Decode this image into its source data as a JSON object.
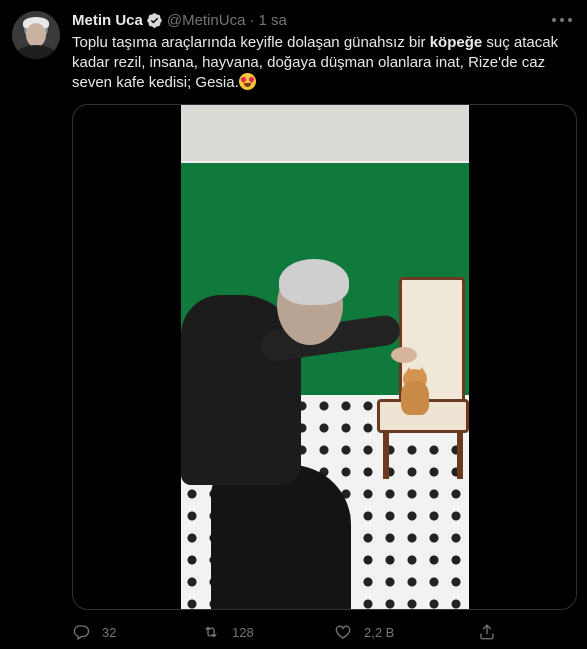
{
  "tweet": {
    "author_name": "Metin Uca",
    "handle": "@MetinUca",
    "separator": "·",
    "time": "1 sa",
    "text_part1": "Toplu taşıma araçlarında keyifle dolaşan günahsız bir ",
    "text_bold": "köpeğe",
    "text_part2": " suç atacak kadar rezil, insana, hayvana, doğaya düşman olanlara inat, Rize'de caz seven kafe kedisi; Gesia.",
    "emoji": "smiling-face-with-heart-eyes"
  },
  "actions": {
    "reply_count": "32",
    "retweet_count": "128",
    "like_count": "2,2 B"
  },
  "icons": [
    "verified-icon",
    "more-icon",
    "reply-icon",
    "retweet-icon",
    "like-icon",
    "share-icon"
  ],
  "colors": {
    "background": "#000000",
    "text": "#e7e9ea",
    "muted": "#71767b",
    "verified": "#d9d9d9",
    "wall_green": "#0f7a3c"
  }
}
